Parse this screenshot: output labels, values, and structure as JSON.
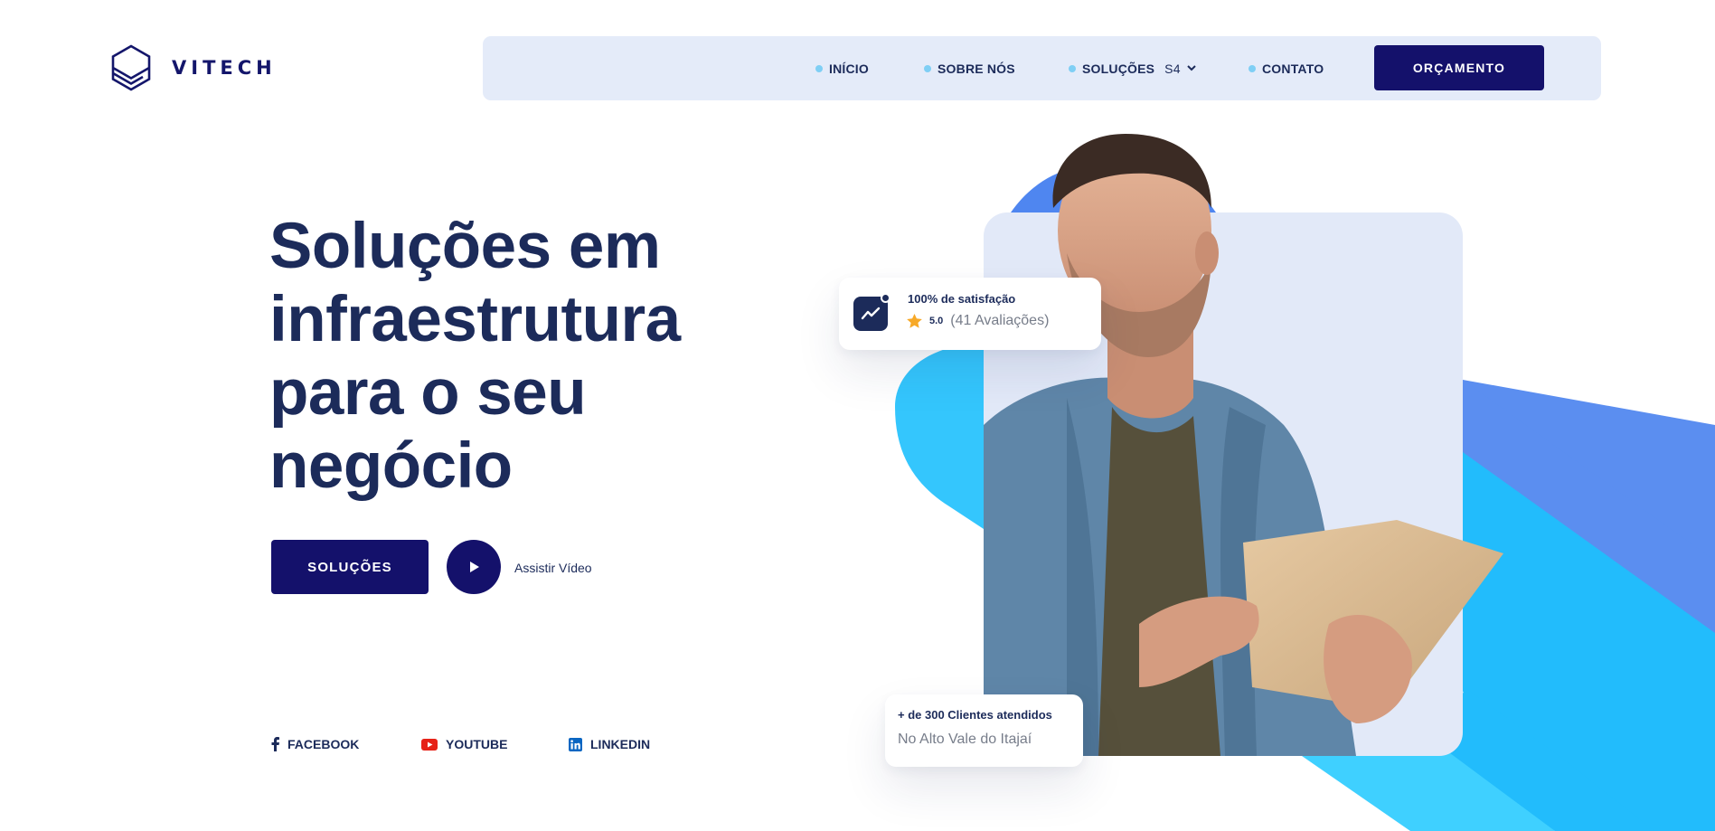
{
  "brand": {
    "name": "VITECH"
  },
  "nav": {
    "items": [
      {
        "label": "INÍCIO"
      },
      {
        "label": "SOBRE NÓS"
      },
      {
        "label": "SOLUÇÕES",
        "sub": "S4"
      },
      {
        "label": "CONTATO"
      }
    ],
    "cta": "ORÇAMENTO"
  },
  "hero": {
    "title": "Soluções em infraestrutura para o seu negócio",
    "primary_button": "SOLUÇÕES",
    "video_label": "Assistir Vídeo"
  },
  "social": [
    {
      "label": "FACEBOOK",
      "icon": "facebook-icon",
      "color": "#1c2b5a"
    },
    {
      "label": "YOUTUBE",
      "icon": "youtube-icon",
      "color": "#e62117"
    },
    {
      "label": "LINKEDIN",
      "icon": "linkedin-icon",
      "color": "#0a66c2"
    }
  ],
  "rating_card": {
    "title": "100% de satisfação",
    "score": "5.0",
    "reviews": "(41 Avaliações)",
    "icon": "chart-trend-icon",
    "star_color": "#f7a928"
  },
  "clients_card": {
    "title": "+ de 300 Clientes atendidos",
    "subtitle": "No Alto Vale do Itajaí"
  },
  "colors": {
    "navy": "#14116b",
    "text": "#1c2b5a",
    "nav_bg": "#e4ebf9",
    "blue": "#5b8ef0",
    "cyan": "#22c0ff",
    "light_cyan": "#3dcfff"
  }
}
